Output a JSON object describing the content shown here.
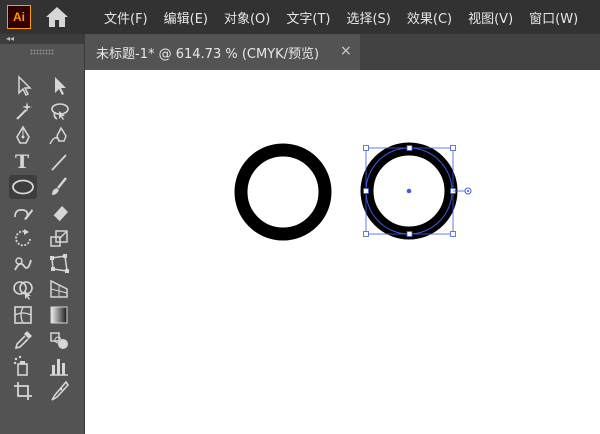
{
  "app": {
    "logo_text": "Ai",
    "brand_color": "#ff9a00",
    "selection_color": "#3f5bde"
  },
  "menu": {
    "items": [
      "文件(F)",
      "编辑(E)",
      "对象(O)",
      "文字(T)",
      "选择(S)",
      "效果(C)",
      "视图(V)",
      "窗口(W)"
    ]
  },
  "toolbar": {
    "collapse_label": "◂◂",
    "tools": [
      {
        "name": "selection-tool-icon"
      },
      {
        "name": "direct-selection-tool-icon"
      },
      {
        "name": "magic-wand-tool-icon"
      },
      {
        "name": "lasso-tool-icon"
      },
      {
        "name": "pen-tool-icon"
      },
      {
        "name": "curvature-tool-icon"
      },
      {
        "name": "type-tool-icon",
        "glyph": "T"
      },
      {
        "name": "line-segment-tool-icon"
      },
      {
        "name": "ellipse-tool-icon",
        "active": true
      },
      {
        "name": "paintbrush-tool-icon"
      },
      {
        "name": "shaper-tool-icon"
      },
      {
        "name": "eraser-tool-icon"
      },
      {
        "name": "rotate-tool-icon"
      },
      {
        "name": "scale-tool-icon"
      },
      {
        "name": "warp-tool-icon"
      },
      {
        "name": "free-transform-tool-icon"
      },
      {
        "name": "shape-builder-tool-icon"
      },
      {
        "name": "perspective-grid-tool-icon"
      },
      {
        "name": "mesh-tool-icon"
      },
      {
        "name": "gradient-tool-icon"
      },
      {
        "name": "eyedropper-tool-icon"
      },
      {
        "name": "blend-tool-icon"
      },
      {
        "name": "symbol-sprayer-tool-icon"
      },
      {
        "name": "column-graph-tool-icon"
      },
      {
        "name": "artboard-tool-icon"
      },
      {
        "name": "slice-tool-icon"
      }
    ]
  },
  "document": {
    "tab_title": "未标题-1* @ 614.73 % (CMYK/预览)",
    "close_glyph": "×"
  }
}
